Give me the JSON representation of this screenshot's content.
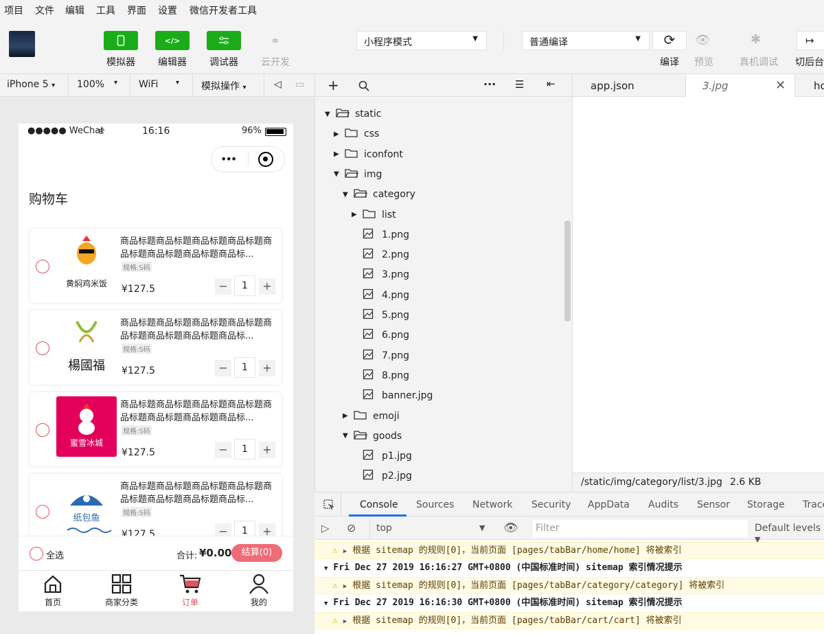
{
  "menu": [
    "项目",
    "文件",
    "编辑",
    "工具",
    "界面",
    "设置",
    "微信开发者工具"
  ],
  "toolbar": {
    "simulator": "模拟器",
    "editor": "编辑器",
    "debugger": "调试器",
    "cloud": "云开发",
    "mode": "小程序模式",
    "compile_mode": "普通编译",
    "compile": "编译",
    "preview": "预览",
    "remote_debug": "真机调试",
    "backend": "切后台"
  },
  "devbar": {
    "device": "iPhone 5",
    "zoom": "100%",
    "network": "WiFi",
    "simulate": "模拟操作"
  },
  "phone": {
    "carrier": "●●●●● WeChat",
    "time": "16:16",
    "battery": "96%",
    "page_title": "购物车",
    "items": [
      {
        "title": "商品标题商品标题商品标题商品标题商品标题商品标题商品标题商品标...",
        "spec": "规格:S码",
        "price": "¥127.5",
        "qty": "1",
        "logo": "黄焖鸡米饭"
      },
      {
        "title": "商品标题商品标题商品标题商品标题商品标题商品标题商品标题商品标...",
        "spec": "规格:S码",
        "price": "¥127.5",
        "qty": "1",
        "logo": "楊國福"
      },
      {
        "title": "商品标题商品标题商品标题商品标题商品标题商品标题商品标题商品标...",
        "spec": "规格:S码",
        "price": "¥127.5",
        "qty": "1",
        "logo": "蜜雪冰城"
      },
      {
        "title": "商品标题商品标题商品标题商品标题商品标题商品标题商品标题商品标...",
        "spec": "规格:S码",
        "price": "¥127.5",
        "qty": "1",
        "logo": "纸包鱼"
      }
    ],
    "select_all": "全选",
    "total_label": "合计:",
    "total_value": "¥0.00",
    "checkout": "结算(0)",
    "tabs": [
      "首页",
      "商家分类",
      "订单",
      "我的"
    ]
  },
  "filetree": [
    {
      "name": "static",
      "type": "folder",
      "open": true,
      "depth": 0
    },
    {
      "name": "css",
      "type": "folder",
      "open": false,
      "depth": 1
    },
    {
      "name": "iconfont",
      "type": "folder",
      "open": false,
      "depth": 1
    },
    {
      "name": "img",
      "type": "folder",
      "open": true,
      "depth": 1
    },
    {
      "name": "category",
      "type": "folder",
      "open": true,
      "depth": 2
    },
    {
      "name": "list",
      "type": "folder",
      "open": false,
      "depth": 3
    },
    {
      "name": "1.png",
      "type": "image",
      "depth": 3
    },
    {
      "name": "2.png",
      "type": "image",
      "depth": 3
    },
    {
      "name": "3.png",
      "type": "image",
      "depth": 3
    },
    {
      "name": "4.png",
      "type": "image",
      "depth": 3
    },
    {
      "name": "5.png",
      "type": "image",
      "depth": 3
    },
    {
      "name": "6.png",
      "type": "image",
      "depth": 3
    },
    {
      "name": "7.png",
      "type": "image",
      "depth": 3
    },
    {
      "name": "8.png",
      "type": "image",
      "depth": 3
    },
    {
      "name": "banner.jpg",
      "type": "image",
      "depth": 3
    },
    {
      "name": "emoji",
      "type": "folder",
      "open": false,
      "depth": 2
    },
    {
      "name": "goods",
      "type": "folder",
      "open": true,
      "depth": 2
    },
    {
      "name": "p1.jpg",
      "type": "image",
      "depth": 3
    },
    {
      "name": "p2.jpg",
      "type": "image",
      "depth": 3
    }
  ],
  "editor": {
    "tab1": "app.json",
    "tab2": "3.jpg",
    "tab3": "ho",
    "path": "/static/img/category/list/3.jpg",
    "size": "2.6 KB"
  },
  "console": {
    "tabs": [
      "Console",
      "Sources",
      "Network",
      "Security",
      "AppData",
      "Audits",
      "Sensor",
      "Storage",
      "Trace"
    ],
    "context": "top",
    "filter_placeholder": "Filter",
    "levels": "Default levels",
    "logs": [
      {
        "type": "warn",
        "text": "根据 sitemap 的规则[0]，当前页面 [pages/tabBar/home/home] 将被索引"
      },
      {
        "type": "info",
        "text": "Fri Dec 27 2019 16:16:27 GMT+0800 (中国标准时间) sitemap 索引情况提示"
      },
      {
        "type": "warn",
        "text": "根据 sitemap 的规则[0]，当前页面 [pages/tabBar/category/category] 将被索引"
      },
      {
        "type": "info",
        "text": "Fri Dec 27 2019 16:16:30 GMT+0800 (中国标准时间) sitemap 索引情况提示"
      },
      {
        "type": "warn",
        "text": "根据 sitemap 的规则[0]，当前页面 [pages/tabBar/cart/cart] 将被索引"
      }
    ]
  },
  "colors": {
    "green": "#1aad19",
    "red": "#e0535e",
    "checkout_bg": "#ef6b77"
  }
}
